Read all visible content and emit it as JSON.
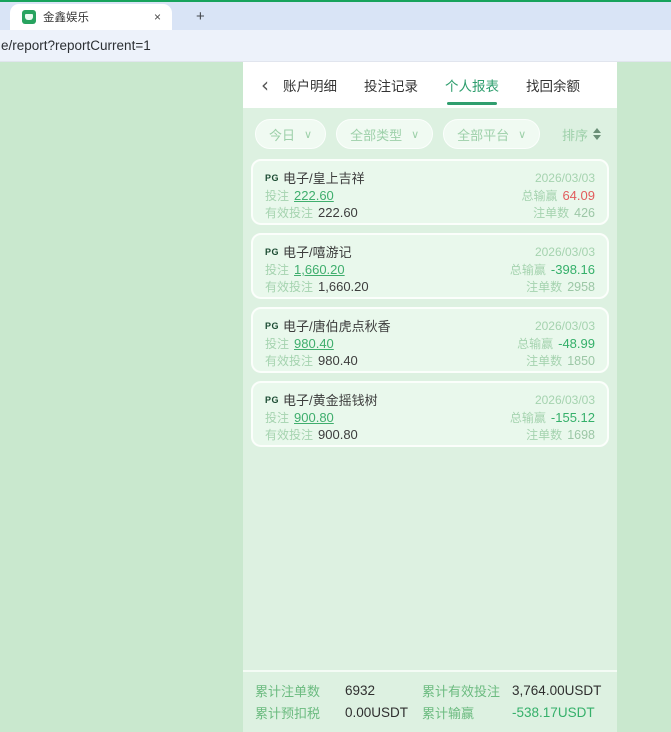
{
  "browser": {
    "tab_title": "金鑫娱乐",
    "close_icon": "×",
    "new_tab_icon": "+",
    "url": "e/report?reportCurrent=1"
  },
  "nav": {
    "back_icon": "‹",
    "tabs": [
      {
        "label": "账户明细"
      },
      {
        "label": "投注记录"
      },
      {
        "label": "个人报表"
      },
      {
        "label": "找回余额"
      }
    ],
    "active_tab": "个人报表"
  },
  "filters": {
    "date": "今日",
    "type": "全部类型",
    "platform": "全部平台",
    "caret_icon": "∨",
    "sort_label": "排序"
  },
  "cards": [
    {
      "provider": "PG",
      "title": "电子/皇上吉祥",
      "date": "2026/03/03",
      "bet_label": "投注",
      "bet_value": "222.60",
      "winloss_label": "总输赢",
      "winloss_value": "64.09",
      "winloss_color": "#e25c5c",
      "valid_bet_label": "有效投注",
      "valid_bet_value": "222.60",
      "orders_label": "注单数",
      "orders_value": "426"
    },
    {
      "provider": "PG",
      "title": "电子/嘻游记",
      "date": "2026/03/03",
      "bet_label": "投注",
      "bet_value": "1,660.20",
      "winloss_label": "总输赢",
      "winloss_value": "-398.16",
      "winloss_color": "#35b06a",
      "valid_bet_label": "有效投注",
      "valid_bet_value": "1,660.20",
      "orders_label": "注单数",
      "orders_value": "2958"
    },
    {
      "provider": "PG",
      "title": "电子/唐伯虎点秋香",
      "date": "2026/03/03",
      "bet_label": "投注",
      "bet_value": "980.40",
      "winloss_label": "总输赢",
      "winloss_value": "-48.99",
      "winloss_color": "#35b06a",
      "valid_bet_label": "有效投注",
      "valid_bet_value": "980.40",
      "orders_label": "注单数",
      "orders_value": "1850"
    },
    {
      "provider": "PG",
      "title": "电子/黄金摇钱树",
      "date": "2026/03/03",
      "bet_label": "投注",
      "bet_value": "900.80",
      "winloss_label": "总输赢",
      "winloss_value": "-155.12",
      "winloss_color": "#35b06a",
      "valid_bet_label": "有效投注",
      "valid_bet_value": "900.80",
      "orders_label": "注单数",
      "orders_value": "1698"
    }
  ],
  "summary": {
    "items": [
      {
        "label": "累计注单数",
        "value": "6932",
        "color": "#2f2f2f"
      },
      {
        "label": "累计有效投注",
        "value": "3,764.00USDT",
        "color": "#2f2f2f"
      },
      {
        "label": "累计预扣税",
        "value": "0.00USDT",
        "color": "#2f2f2f"
      },
      {
        "label": "累计输赢",
        "value": "-538.17USDT",
        "color": "#35b06a"
      }
    ]
  },
  "colors": {
    "accent_green": "#2f9e6e",
    "outer_background": "#c9e8ce",
    "panel_background": "#ddf1e1",
    "positive_red": "#e25c5c",
    "negative_green": "#35b06a"
  }
}
